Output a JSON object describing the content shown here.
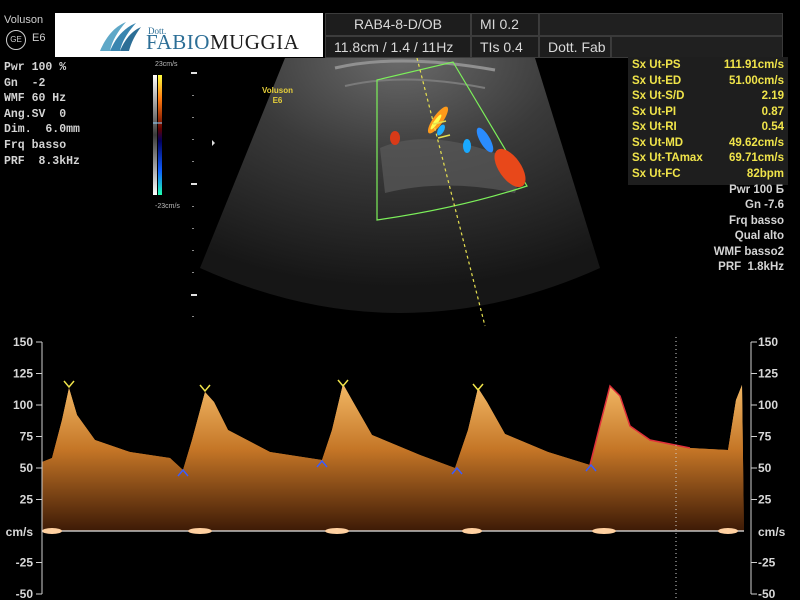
{
  "header": {
    "brand": "Voluson",
    "ge_logo": "GE",
    "model": "E6",
    "logo": {
      "prefix": "Dott.",
      "first": "FABIO",
      "last": "MUGGIA",
      "icon": "leaf-logo-icon",
      "color": "#2c6e96"
    },
    "probe": "RAB4-8-D/OB",
    "mi": "MI 0.2",
    "depth": "11.8cm / 1.4 / 11Hz",
    "tis": "TIs 0.4",
    "operator": "Dott. Fab"
  },
  "left_params": [
    "Pwr 100 %",
    "Gn  -2",
    "WMF 60 Hz",
    "Ang.SV  0",
    "Dim.  6.0mm",
    "Frq basso",
    "PRF  8.3kHz"
  ],
  "color_scale": {
    "top": "23cm/s",
    "bottom": "-23cm/s"
  },
  "image_label": {
    "line1": "Voluson",
    "line2": "E6"
  },
  "measurements": [
    {
      "label": "Sx Ut-PS",
      "value": "111.91cm/s"
    },
    {
      "label": "Sx Ut-ED",
      "value": "51.00cm/s"
    },
    {
      "label": "Sx Ut-S/D",
      "value": "2.19"
    },
    {
      "label": "Sx Ut-PI",
      "value": "0.87"
    },
    {
      "label": "Sx Ut-RI",
      "value": "0.54"
    },
    {
      "label": "Sx Ut-MD",
      "value": "49.62cm/s"
    },
    {
      "label": "Sx Ut-TAmax",
      "value": "69.71cm/s"
    },
    {
      "label": "Sx Ut-FC",
      "value": "82bpm"
    }
  ],
  "right_params": [
    "Pwr 100 Б",
    "Gn -7.6",
    "Frq basso",
    "Qual alto",
    "WMF basso2",
    "PRF  1.8kHz"
  ],
  "doppler_axis": {
    "unit": "cm/s",
    "ticks": [
      "150",
      "125",
      "100",
      "75",
      "50",
      "25",
      "-25",
      "-50"
    ],
    "tick_values": [
      150,
      125,
      100,
      75,
      50,
      25,
      -25,
      -50
    ],
    "range": [
      -50,
      150
    ]
  },
  "colors": {
    "measure": "#f0e44a",
    "spectral": "#c7772a",
    "sector": "#7cf05a"
  }
}
